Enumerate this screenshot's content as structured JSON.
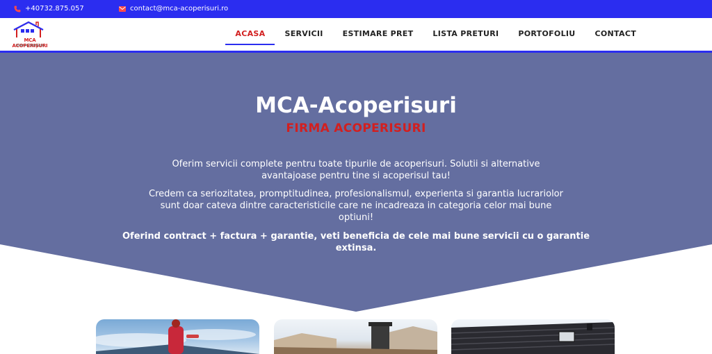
{
  "topbar": {
    "phone": "+40732.875.057",
    "email": "contact@mca-acoperisuri.ro",
    "phone_icon": "phone-icon",
    "email_icon": "envelope-icon"
  },
  "logo": {
    "name": "MCA ACOPERIȘURI",
    "tagline": "FIRMA ACOPERIȘURI"
  },
  "nav": {
    "items": [
      "ACASA",
      "SERVICII",
      "ESTIMARE PRET",
      "LISTA PRETURI",
      "PORTOFOLIU",
      "CONTACT"
    ],
    "active_index": 0
  },
  "hero": {
    "title": "MCA-Acoperisuri",
    "subtitle": "FIRMA ACOPERISURI",
    "paragraph1_line1": "Oferim servicii complete pentru toate tipurile de acoperisuri. Solutii si alternative",
    "paragraph1_line2": "avantajoase pentru tine si acoperisul tau!",
    "paragraph2_line1": "Credem ca seriozitatea, promptitudinea, profesionalismul, experienta si garantia lucrariolor",
    "paragraph2_line2": "sunt doar cateva dintre caracteristicile care ne incadreaza in categoria celor mai bune",
    "paragraph2_line3": "optiuni!",
    "paragraph3_line1": "Oferind contract + factura + garantie, veti beneficia de cele mai bune servicii cu o garantie",
    "paragraph3_line2": "extinsa."
  },
  "colors": {
    "topbar": "#2b2df0",
    "hero": "#646ea0",
    "accent_red": "#d21f1f"
  }
}
